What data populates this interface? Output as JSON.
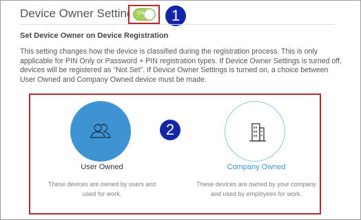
{
  "header": {
    "title": "Device Owner Settings",
    "toggle": {
      "label": "ON",
      "state": "on",
      "color": "#a7cf5b"
    }
  },
  "callouts": [
    "1",
    "2"
  ],
  "section": {
    "title": "Set Device Owner on Device Registration",
    "description": "This setting changes how the device is classified during the registration process. This is only applicable for PIN Only or Password + PIN registration types. If Device Owner Settings is turned off, devices will be registered as \"Not Set\". If Device Owner Settings is turned on, a choice between User Owned and Company Owned device must be made."
  },
  "options": [
    {
      "name": "User Owned",
      "description": "These devices are owned by users and used for work.",
      "icon": "users-icon",
      "selected": true
    },
    {
      "name": "Company Owned",
      "description": "These devices are owned by your company and used by employees for work.",
      "icon": "building-icon",
      "selected": false
    }
  ],
  "colors": {
    "accent": "#3e93d3",
    "callout": "#1426a8",
    "highlight_border": "#b3272d"
  }
}
